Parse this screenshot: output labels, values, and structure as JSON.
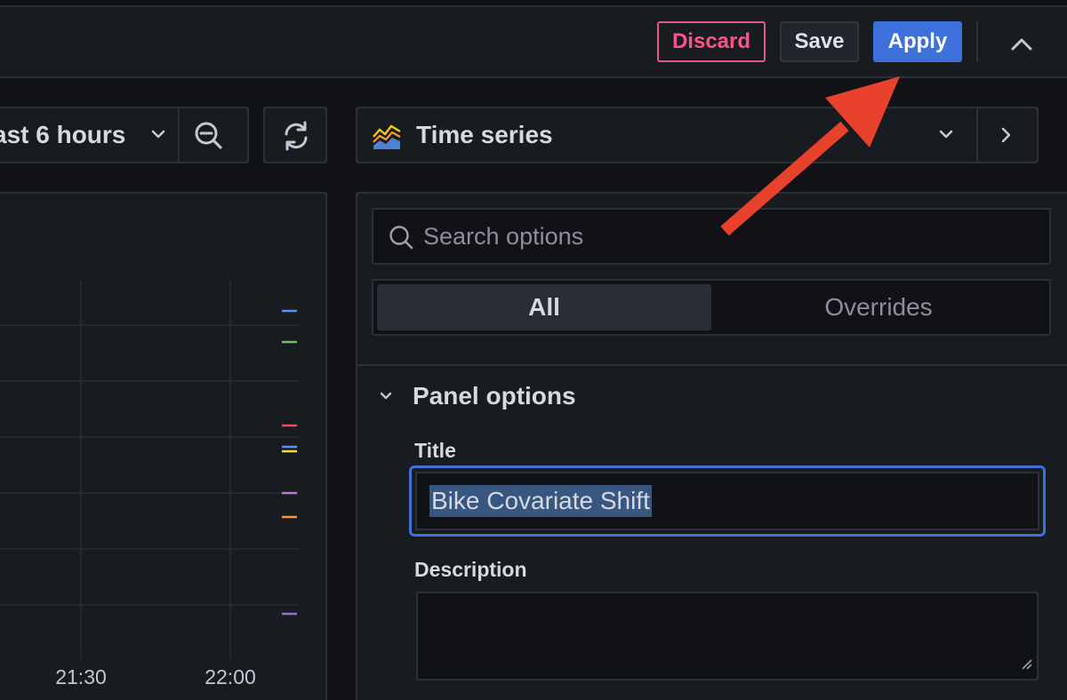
{
  "toolbar": {
    "discard_label": "Discard",
    "save_label": "Save",
    "apply_label": "Apply"
  },
  "time_picker": {
    "label": "ast 6 hours"
  },
  "graph": {
    "x_ticks": [
      "21:30",
      "22:00"
    ],
    "series_colors": [
      "#5794f2",
      "#73bf69",
      "#f2495c",
      "#5794f2",
      "#fade2a",
      "#b877d9",
      "#ff9830",
      "#8f71d9"
    ]
  },
  "visualization": {
    "name": "Time series"
  },
  "options": {
    "search_placeholder": "Search options",
    "tabs": [
      {
        "label": "All",
        "active": true
      },
      {
        "label": "Overrides",
        "active": false
      }
    ],
    "section_title": "Panel options",
    "title_label": "Title",
    "title_value": "Bike Covariate Shift",
    "description_label": "Description",
    "description_value": ""
  },
  "colors": {
    "accent": "#3d71d9",
    "discard": "#ff5286",
    "annotation_arrow": "#e8412c"
  }
}
